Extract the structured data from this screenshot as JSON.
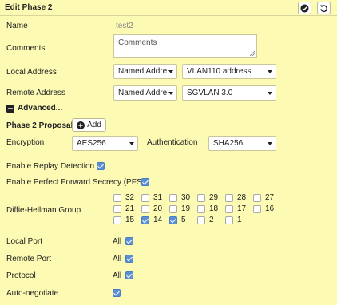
{
  "header": {
    "title": "Edit Phase 2",
    "confirm_icon": "check-circle-icon",
    "revert_icon": "undo-icon"
  },
  "name": {
    "label": "Name",
    "value": "test2"
  },
  "comments": {
    "label": "Comments",
    "placeholder": "Comments"
  },
  "local_address": {
    "label": "Local Address",
    "type": "Named Addre",
    "value": "VLAN110 address"
  },
  "remote_address": {
    "label": "Remote Address",
    "type": "Named Addre",
    "value": "SGVLAN 3.0"
  },
  "advanced": {
    "label": "Advanced...",
    "icon": "minus-square-icon"
  },
  "proposal": {
    "label": "Phase 2 Proposal",
    "add_label": "Add",
    "add_icon": "plus-circle-icon"
  },
  "encryption": {
    "label": "Encryption",
    "value": "AES256"
  },
  "authentication": {
    "label": "Authentication",
    "value": "SHA256"
  },
  "replay": {
    "label": "Enable Replay Detection",
    "checked": true
  },
  "pfs": {
    "label": "Enable Perfect Forward Secrecy (PFS)",
    "checked": true
  },
  "dh": {
    "label": "Diffie-Hellman Group",
    "groups": [
      {
        "num": "32",
        "checked": false
      },
      {
        "num": "31",
        "checked": false
      },
      {
        "num": "30",
        "checked": false
      },
      {
        "num": "29",
        "checked": false
      },
      {
        "num": "28",
        "checked": false
      },
      {
        "num": "27",
        "checked": false
      },
      {
        "num": "21",
        "checked": false
      },
      {
        "num": "20",
        "checked": false
      },
      {
        "num": "19",
        "checked": false
      },
      {
        "num": "18",
        "checked": false
      },
      {
        "num": "17",
        "checked": false
      },
      {
        "num": "16",
        "checked": false
      },
      {
        "num": "15",
        "checked": false
      },
      {
        "num": "14",
        "checked": true
      },
      {
        "num": "5",
        "checked": true
      },
      {
        "num": "2",
        "checked": false
      },
      {
        "num": "1",
        "checked": false
      }
    ]
  },
  "local_port": {
    "label": "Local Port",
    "value": "All",
    "checked": true
  },
  "remote_port": {
    "label": "Remote Port",
    "value": "All",
    "checked": true
  },
  "protocol": {
    "label": "Protocol",
    "value": "All",
    "checked": true
  },
  "auto_negotiate": {
    "label": "Auto-negotiate",
    "checked": true
  },
  "colors": {
    "background": "#fdfbb3",
    "accent": "#5b8fd6"
  }
}
